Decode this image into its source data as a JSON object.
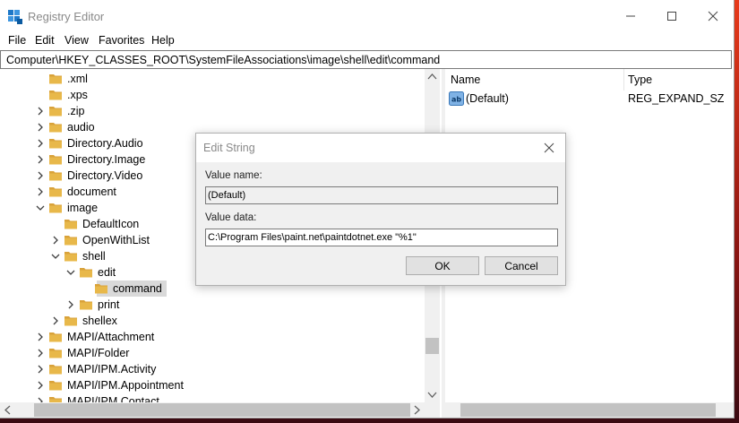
{
  "window": {
    "title": "Registry Editor"
  },
  "menu": [
    "File",
    "Edit",
    "View",
    "Favorites",
    "Help"
  ],
  "address": "Computer\\HKEY_CLASSES_ROOT\\SystemFileAssociations\\image\\shell\\edit\\command",
  "tree": [
    {
      "label": ".xml",
      "depth": 0,
      "chevron": "none"
    },
    {
      "label": ".xps",
      "depth": 0,
      "chevron": "none"
    },
    {
      "label": ".zip",
      "depth": 0,
      "chevron": "right"
    },
    {
      "label": "audio",
      "depth": 0,
      "chevron": "right"
    },
    {
      "label": "Directory.Audio",
      "depth": 0,
      "chevron": "right"
    },
    {
      "label": "Directory.Image",
      "depth": 0,
      "chevron": "right"
    },
    {
      "label": "Directory.Video",
      "depth": 0,
      "chevron": "right"
    },
    {
      "label": "document",
      "depth": 0,
      "chevron": "right"
    },
    {
      "label": "image",
      "depth": 0,
      "chevron": "down"
    },
    {
      "label": "DefaultIcon",
      "depth": 1,
      "chevron": "none"
    },
    {
      "label": "OpenWithList",
      "depth": 1,
      "chevron": "right"
    },
    {
      "label": "shell",
      "depth": 1,
      "chevron": "down"
    },
    {
      "label": "edit",
      "depth": 2,
      "chevron": "down"
    },
    {
      "label": "command",
      "depth": 3,
      "chevron": "none",
      "selected": true
    },
    {
      "label": "print",
      "depth": 2,
      "chevron": "right"
    },
    {
      "label": "shellex",
      "depth": 1,
      "chevron": "right"
    },
    {
      "label": "MAPI/Attachment",
      "depth": 0,
      "chevron": "right"
    },
    {
      "label": "MAPI/Folder",
      "depth": 0,
      "chevron": "right"
    },
    {
      "label": "MAPI/IPM.Activity",
      "depth": 0,
      "chevron": "right"
    },
    {
      "label": "MAPI/IPM.Appointment",
      "depth": 0,
      "chevron": "right"
    },
    {
      "label": "MAPI/IPM.Contact",
      "depth": 0,
      "chevron": "right"
    }
  ],
  "list": {
    "headers": {
      "name": "Name",
      "type": "Type"
    },
    "rows": [
      {
        "icon": "ab",
        "name": "(Default)",
        "type": "REG_EXPAND_SZ"
      }
    ]
  },
  "dialog": {
    "title": "Edit String",
    "value_name_label": "Value name:",
    "value_name": "(Default)",
    "value_data_label": "Value data:",
    "value_data": "C:\\Program Files\\paint.net\\paintdotnet.exe \"%1\"",
    "ok_label": "OK",
    "cancel_label": "Cancel"
  },
  "colors": {
    "folder": "#e8b84a",
    "selection": "#d9d9d9",
    "accent": "#1e78c8"
  }
}
